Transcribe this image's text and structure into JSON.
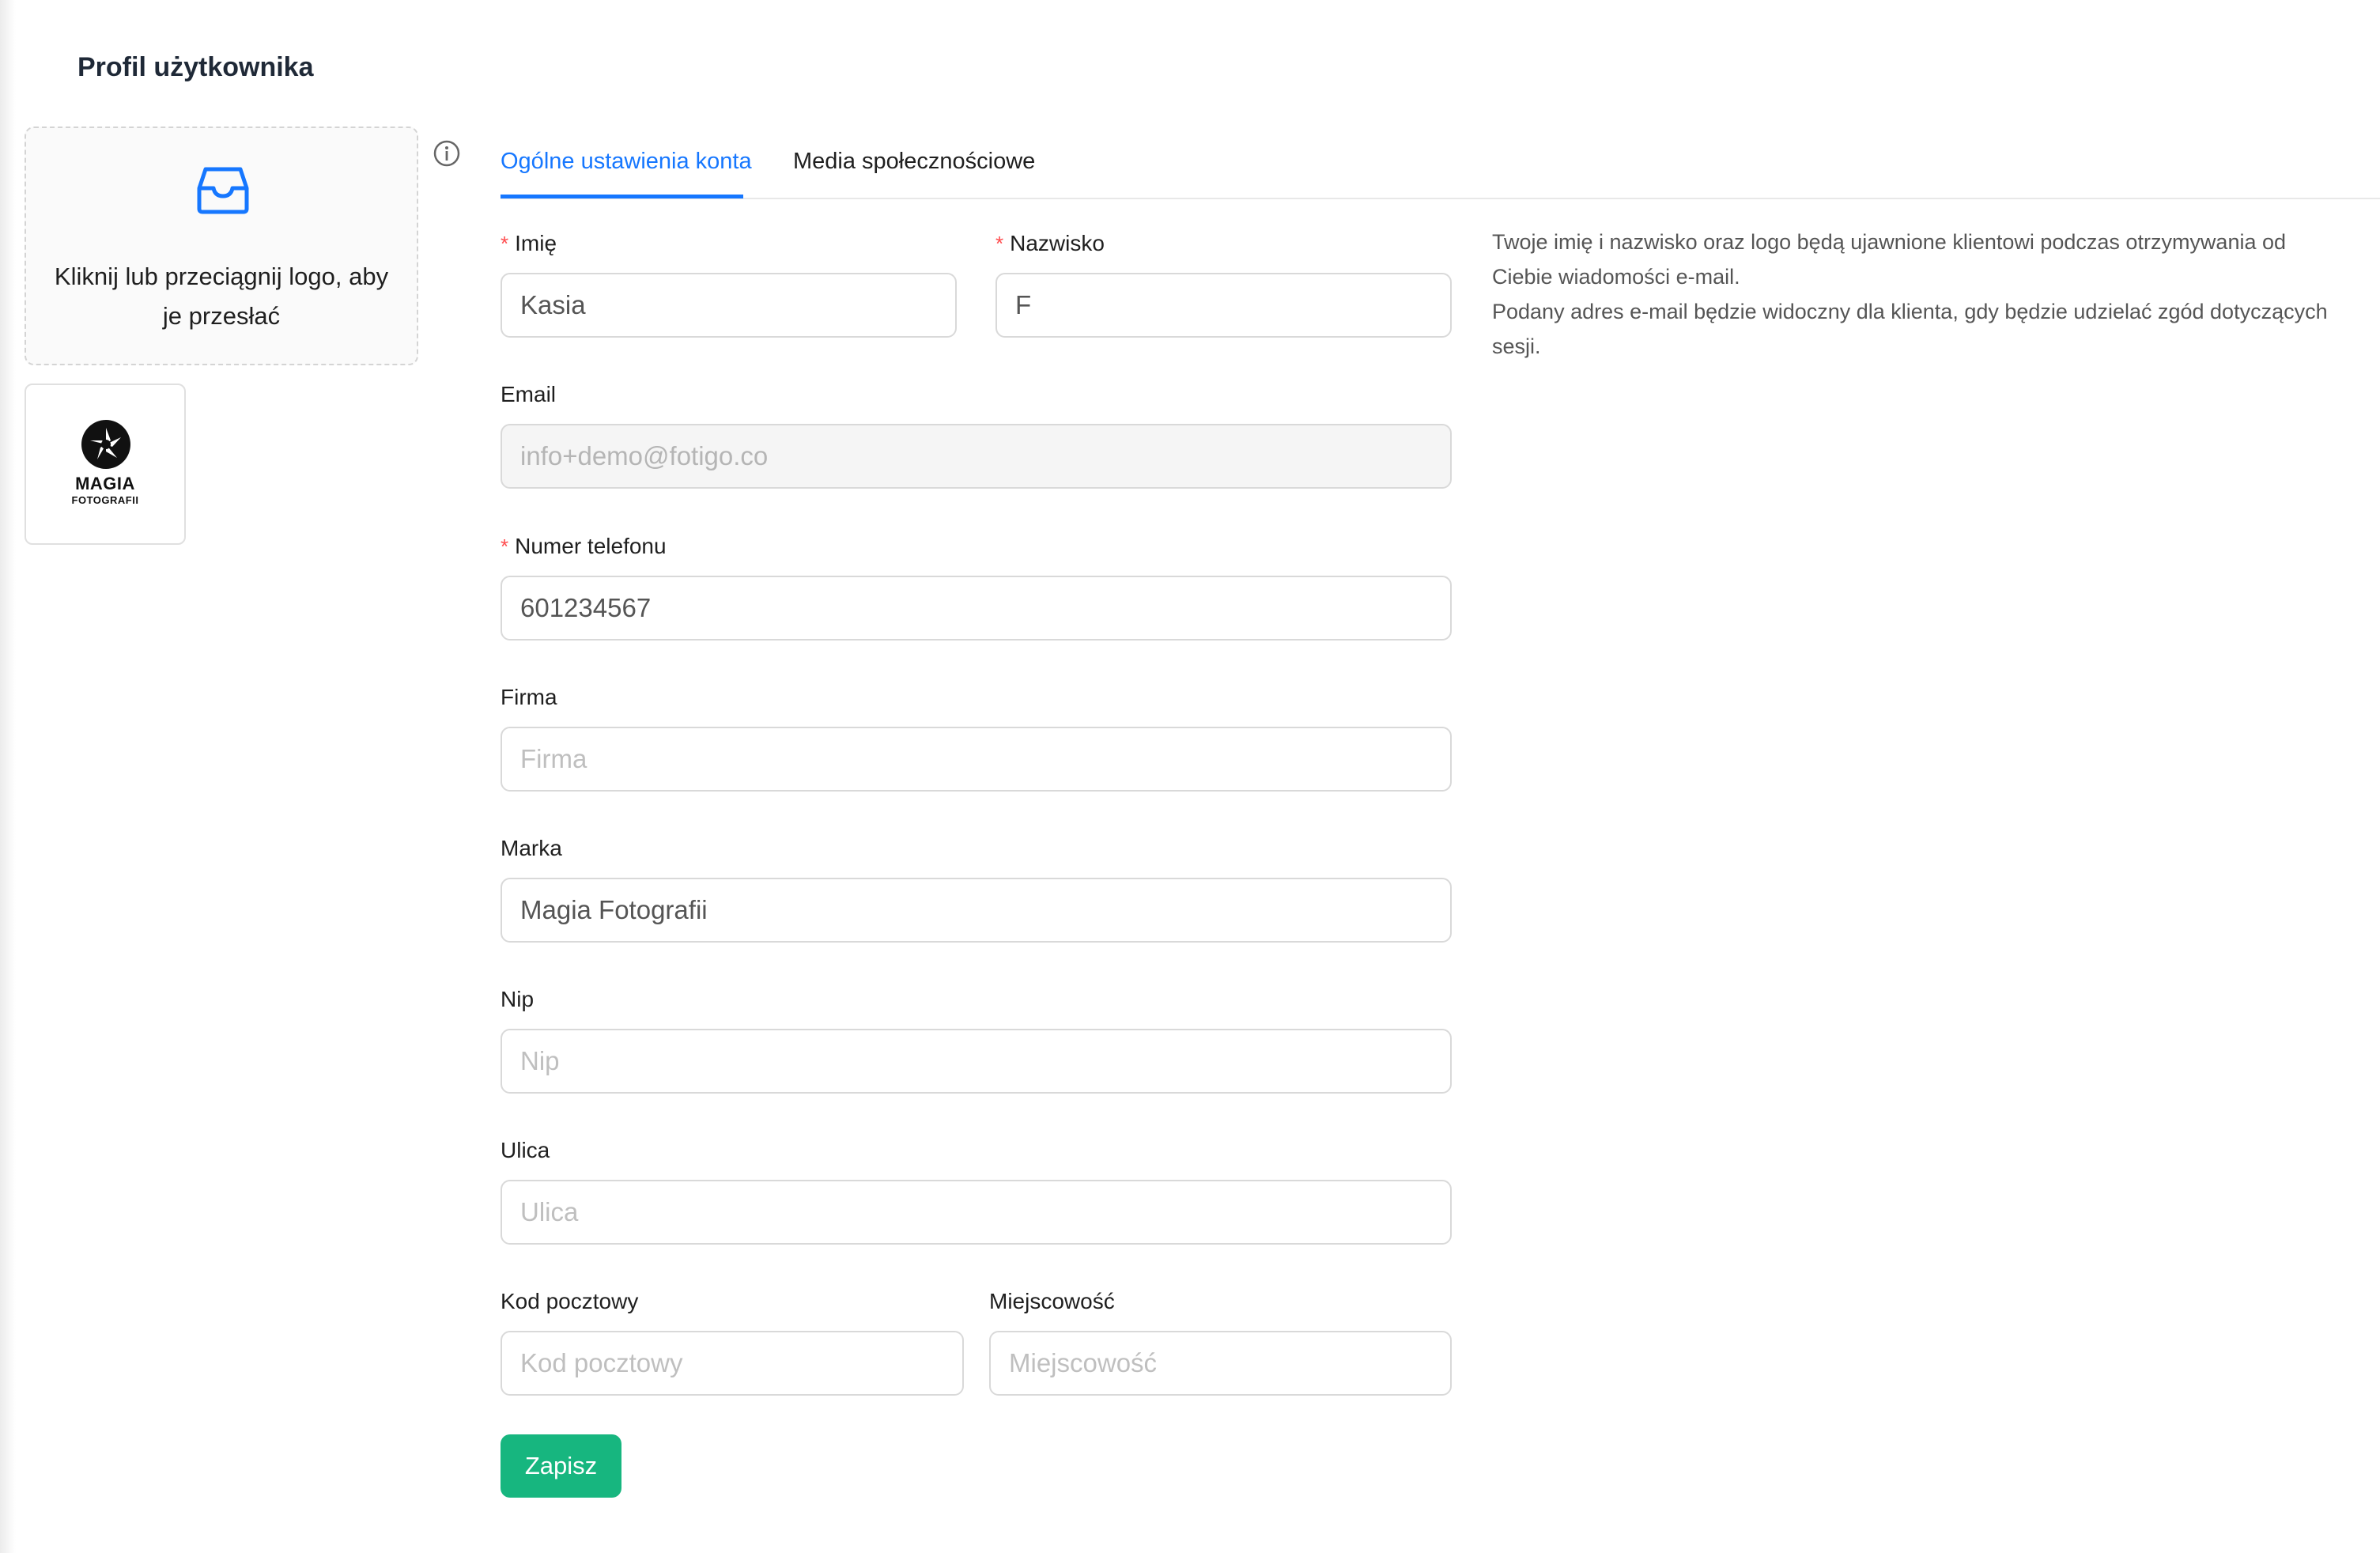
{
  "page": {
    "title": "Profil użytkownika"
  },
  "upload": {
    "text": "Kliknij lub przeciągnij logo, aby je przesłać",
    "icon": "inbox-icon"
  },
  "logo": {
    "name": "MAGIA",
    "sub": "FOTOGRAFII",
    "icon": "camera-aperture-icon"
  },
  "info_icon": "info-circle-icon",
  "tabs": [
    {
      "label": "Ogólne ustawienia konta",
      "active": true
    },
    {
      "label": "Media społecznościowe",
      "active": false
    }
  ],
  "form": {
    "first_name": {
      "label": "Imię",
      "value": "Kasia",
      "placeholder": "",
      "required": true
    },
    "last_name": {
      "label": "Nazwisko",
      "value": "F",
      "placeholder": "",
      "required": true
    },
    "email": {
      "label": "Email",
      "value": "info+demo@fotigo.co",
      "placeholder": "",
      "disabled": true
    },
    "phone": {
      "label": "Numer telefonu",
      "value": "601234567",
      "placeholder": "",
      "required": true
    },
    "company": {
      "label": "Firma",
      "value": "",
      "placeholder": "Firma"
    },
    "brand": {
      "label": "Marka",
      "value": "Magia Fotografii",
      "placeholder": ""
    },
    "nip": {
      "label": "Nip",
      "value": "",
      "placeholder": "Nip"
    },
    "street": {
      "label": "Ulica",
      "value": "",
      "placeholder": "Ulica"
    },
    "postal_code": {
      "label": "Kod pocztowy",
      "value": "",
      "placeholder": "Kod pocztowy"
    },
    "city": {
      "label": "Miejscowość",
      "value": "",
      "placeholder": "Miejscowość"
    }
  },
  "side_note": {
    "line1": "Twoje imię i nazwisko oraz logo będą ujawnione klientowi podczas otrzymywania od Ciebie wiadomości e-mail.",
    "line2": "Podany adres e-mail będzie widoczny dla klienta, gdy będzie udzielać zgód dotyczących sesji."
  },
  "save_button": {
    "label": "Zapisz"
  },
  "colors": {
    "accent": "#1677ff",
    "success": "#17b67f",
    "required": "#ff4d4f"
  }
}
